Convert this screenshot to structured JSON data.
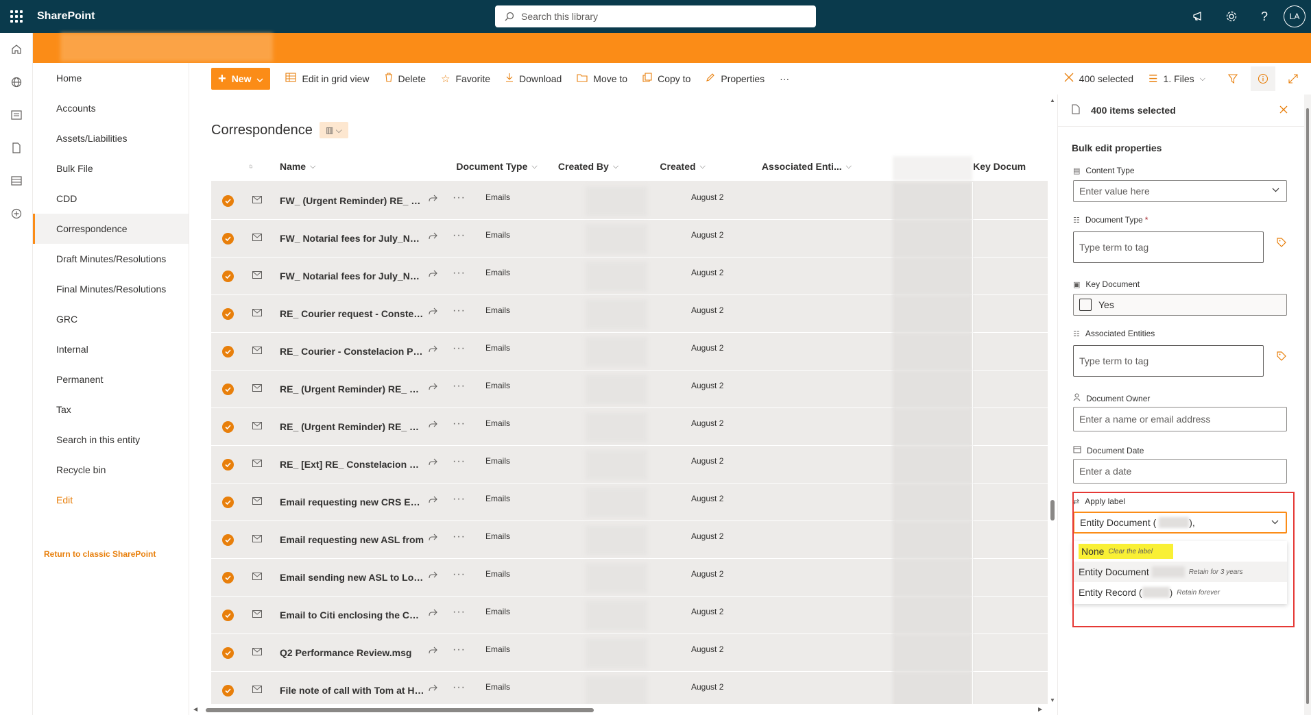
{
  "suitebar": {
    "brand": "SharePoint",
    "search_placeholder": "Search this library",
    "avatar_initials": "LA"
  },
  "leftnav": {
    "items": [
      {
        "label": "Home"
      },
      {
        "label": "Accounts"
      },
      {
        "label": "Assets/Liabilities"
      },
      {
        "label": "Bulk File"
      },
      {
        "label": "CDD"
      },
      {
        "label": "Correspondence",
        "selected": true
      },
      {
        "label": "Draft Minutes/Resolutions"
      },
      {
        "label": "Final Minutes/Resolutions"
      },
      {
        "label": "GRC"
      },
      {
        "label": "Internal"
      },
      {
        "label": "Permanent"
      },
      {
        "label": "Tax"
      },
      {
        "label": "Search in this entity"
      },
      {
        "label": "Recycle bin"
      },
      {
        "label": "Edit"
      }
    ],
    "classic_link": "Return to classic SharePoint"
  },
  "commandbar": {
    "new_label": "New",
    "edit_grid": "Edit in grid view",
    "delete": "Delete",
    "favorite": "Favorite",
    "download": "Download",
    "move_to": "Move to",
    "copy_to": "Copy to",
    "properties": "Properties",
    "more": "···",
    "selected_count": "400 selected",
    "view_name": "1. Files"
  },
  "library": {
    "title": "Correspondence",
    "columns": {
      "name": "Name",
      "doc_type": "Document Type",
      "created_by": "Created By",
      "created": "Created",
      "associated": "Associated Enti...",
      "key_doc": "Key Docum"
    },
    "rows": [
      {
        "name": "FW_ (Urgent Reminder) RE_ RE_ Constelacion",
        "type": "Emails",
        "created": "August 2"
      },
      {
        "name": "FW_ Notarial fees for July_Notice",
        "type": "Emails",
        "created": "August 2"
      },
      {
        "name": "FW_ Notarial fees for July_Notice",
        "type": "Emails",
        "created": "August 2"
      },
      {
        "name": "RE_ Courier request - Constelacion",
        "type": "Emails",
        "created": "August 2"
      },
      {
        "name": "RE_ Courier - Constelacion Pte Ltd",
        "type": "Emails",
        "created": "August 2"
      },
      {
        "name": "RE_ (Urgent Reminder) RE_ RE_ Constelacion",
        "type": "Emails",
        "created": "August 2"
      },
      {
        "name": "RE_ (Urgent Reminder) RE_ RE_ Constelacion",
        "type": "Emails",
        "created": "August 2"
      },
      {
        "name": "RE_ [Ext] RE_ Constelacion Pte Ltd",
        "type": "Emails",
        "created": "August 2"
      },
      {
        "name": "Email requesting new CRS Entity",
        "type": "Emails",
        "created": "August 2"
      },
      {
        "name": "Email requesting new ASL from",
        "type": "Emails",
        "created": "August 2"
      },
      {
        "name": "Email sending new ASL to Lombard",
        "type": "Emails",
        "created": "August 2"
      },
      {
        "name": "Email to Citi enclosing the CRS form",
        "type": "Emails",
        "created": "August 2"
      },
      {
        "name": "Q2 Performance Review.msg",
        "type": "Emails",
        "created": "August 2"
      },
      {
        "name": "File note of call with Tom at HSBC",
        "type": "Emails",
        "created": "August 2"
      }
    ]
  },
  "pane": {
    "header": "400 items selected",
    "section_title": "Bulk edit properties",
    "content_type_label": "Content Type",
    "content_type_placeholder": "Enter value here",
    "document_type_label": "Document Type",
    "document_type_required": "*",
    "term_placeholder": "Type term to tag",
    "key_document_label": "Key Document",
    "key_document_value": "Yes",
    "associated_label": "Associated Entities",
    "owner_label": "Document Owner",
    "owner_placeholder": "Enter a name or email address",
    "date_label": "Document Date",
    "date_placeholder": "Enter a date",
    "apply_label": "Apply label",
    "apply_value": "Entity Document (",
    "apply_value_end": "),",
    "options": [
      {
        "label": "None",
        "note": "Clear the label"
      },
      {
        "label": "Entity Document",
        "note": "Retain for 3 years"
      },
      {
        "label": "Entity Record (",
        "label_end": ")",
        "note": "Retain forever"
      }
    ]
  },
  "colors": {
    "suitebar": "#0a3a4c",
    "accent": "#fb8c17",
    "accent_text": "#e87f0b",
    "highlight": "#f9f035",
    "annotation_red": "#e53935"
  }
}
